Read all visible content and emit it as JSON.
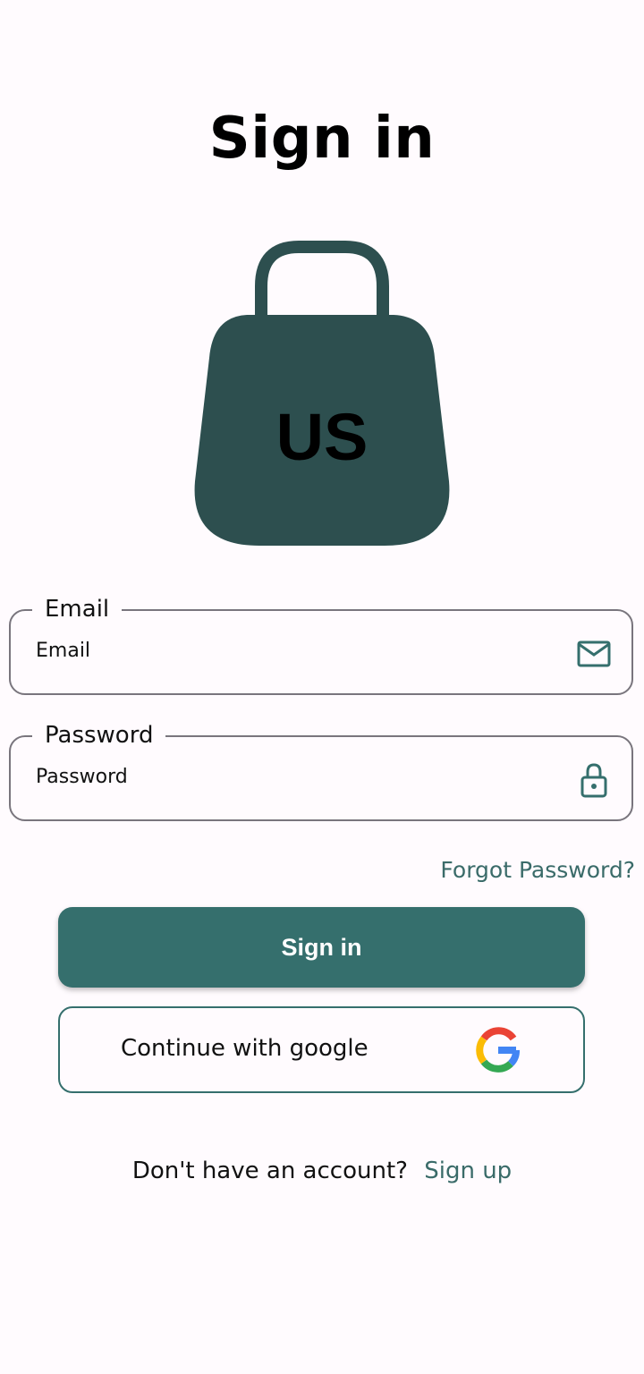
{
  "header": {
    "title": "Sign in"
  },
  "logo": {
    "text": "US",
    "color": "#2d4f4f"
  },
  "form": {
    "email": {
      "label": "Email",
      "placeholder": "Email",
      "icon": "mail-icon"
    },
    "password": {
      "label": "Password",
      "placeholder": "Password",
      "icon": "lock-icon"
    },
    "forgot_label": "Forgot Password?"
  },
  "actions": {
    "signin_label": "Sign in",
    "google_label": "Continue with google",
    "google_icon": "google-icon"
  },
  "footer": {
    "prompt": "Don't have an account?",
    "signup_label": "Sign up"
  },
  "colors": {
    "primary": "#356f6d",
    "link": "#3a6b69",
    "logo": "#2d4f4f",
    "outline": "#79757d",
    "background": "#fffbfe"
  }
}
